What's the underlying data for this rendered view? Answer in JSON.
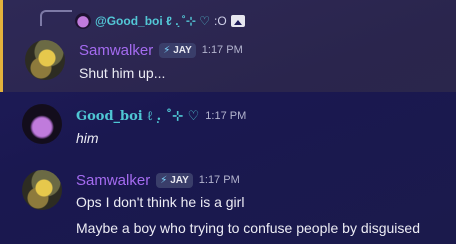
{
  "reply": {
    "username": "@Good_boi ℓ .̣ ˚⊹ ♡",
    "preview": ":O"
  },
  "messages": [
    {
      "username": "Samwalker",
      "tag": "JAY",
      "time": "1:17 PM",
      "lines": [
        "Shut him up..."
      ]
    },
    {
      "username": "Good_boi ℓ .̣ ˚⊹ ♡",
      "time": "1:17 PM",
      "lines": [
        "him"
      ]
    },
    {
      "username": "Samwalker",
      "tag": "JAY",
      "time": "1:17 PM",
      "lines": [
        "Ops I don't think he is a girl",
        "Maybe a boy who trying to confuse people by disguised"
      ]
    }
  ],
  "colors": {
    "highlight_border": "#e3b23c",
    "samwalker_name": "#a46bf0",
    "goodboi_name": "#4fc7d4"
  },
  "icons": {
    "reply_attachment": "image-icon",
    "tag": "lightning-bolt-icon"
  }
}
